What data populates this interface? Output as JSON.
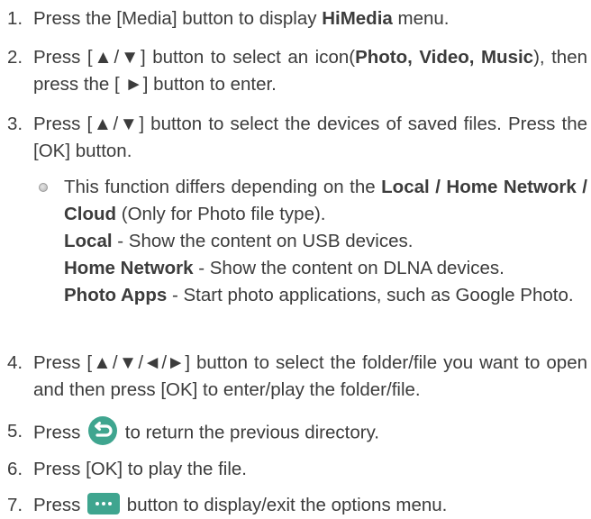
{
  "steps": [
    {
      "num": "1.",
      "parts": [
        "Press the [Media] button to display ",
        "HiMedia",
        " menu."
      ]
    },
    {
      "num": "2.",
      "parts": [
        "Press [▲/▼] button to select an icon(",
        "Photo, Video, Music",
        "), then press the [ ►] button to enter."
      ]
    },
    {
      "num": "3.",
      "parts": [
        "Press [▲/▼] button to select the devices of saved files. Press the [OK] button."
      ]
    },
    {
      "num": "4.",
      "parts": [
        "Press [▲/▼/◄/►] button to select the folder/file you want to open and then press [OK] to enter/play the folder/file."
      ]
    },
    {
      "num": "5.",
      "parts": [
        "Press ",
        " to return the previous directory."
      ],
      "icon": "back-icon"
    },
    {
      "num": "6.",
      "parts": [
        "Press [OK] to play the file."
      ]
    },
    {
      "num": "7.",
      "parts": [
        "Press ",
        " button to display/exit the options menu."
      ],
      "icon": "more-options-icon"
    }
  ],
  "note": {
    "intro": [
      "This function differs depending on the ",
      "Local / Home Network / Cloud",
      " (Only for Photo file type)."
    ],
    "items": [
      {
        "term": "Local",
        "desc": " - Show the content on USB devices."
      },
      {
        "term": "Home Network",
        "desc": " - Show the content on DLNA devices."
      },
      {
        "term": "Photo Apps",
        "desc": " - Start photo applications, such as Google Photo."
      }
    ]
  },
  "colors": {
    "text": "#3c3c3c",
    "icon_accent": "#3fa58f"
  }
}
